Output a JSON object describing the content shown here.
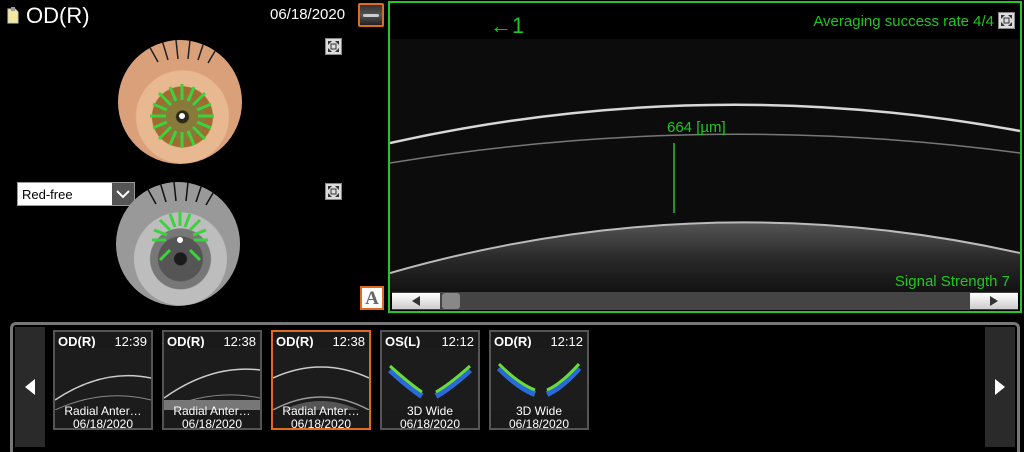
{
  "header": {
    "eye": "OD(R)",
    "date": "06/18/2020"
  },
  "fundus_panel": {
    "filter_value": "Red-free"
  },
  "oct": {
    "arrow_label": "←1",
    "averaging": "Averaging success rate 4/4",
    "measurement": "664 [µm]",
    "signal": "Signal Strength 7"
  },
  "annotation_button": "A",
  "thumbnails": [
    {
      "eye": "OD(R)",
      "time": "12:39",
      "type": "Radial Anter…",
      "date": "06/18/2020",
      "kind": "anterior"
    },
    {
      "eye": "OD(R)",
      "time": "12:38",
      "type": "Radial Anter…",
      "date": "06/18/2020",
      "kind": "anterior"
    },
    {
      "eye": "OD(R)",
      "time": "12:38",
      "type": "Radial Anter…",
      "date": "06/18/2020",
      "kind": "anterior",
      "selected": true
    },
    {
      "eye": "OS(L)",
      "time": "12:12",
      "type": "3D Wide",
      "date": "06/18/2020",
      "kind": "retina"
    },
    {
      "eye": "OD(R)",
      "time": "12:12",
      "type": "3D Wide",
      "date": "06/18/2020",
      "kind": "retina"
    }
  ],
  "colors": {
    "accent_green": "#1ec81e",
    "selection_orange": "#e06a20"
  },
  "icons": [
    "document-icon",
    "expand-icon",
    "chevron-down-icon",
    "triangle-left-icon",
    "triangle-right-icon",
    "pin-icon"
  ]
}
